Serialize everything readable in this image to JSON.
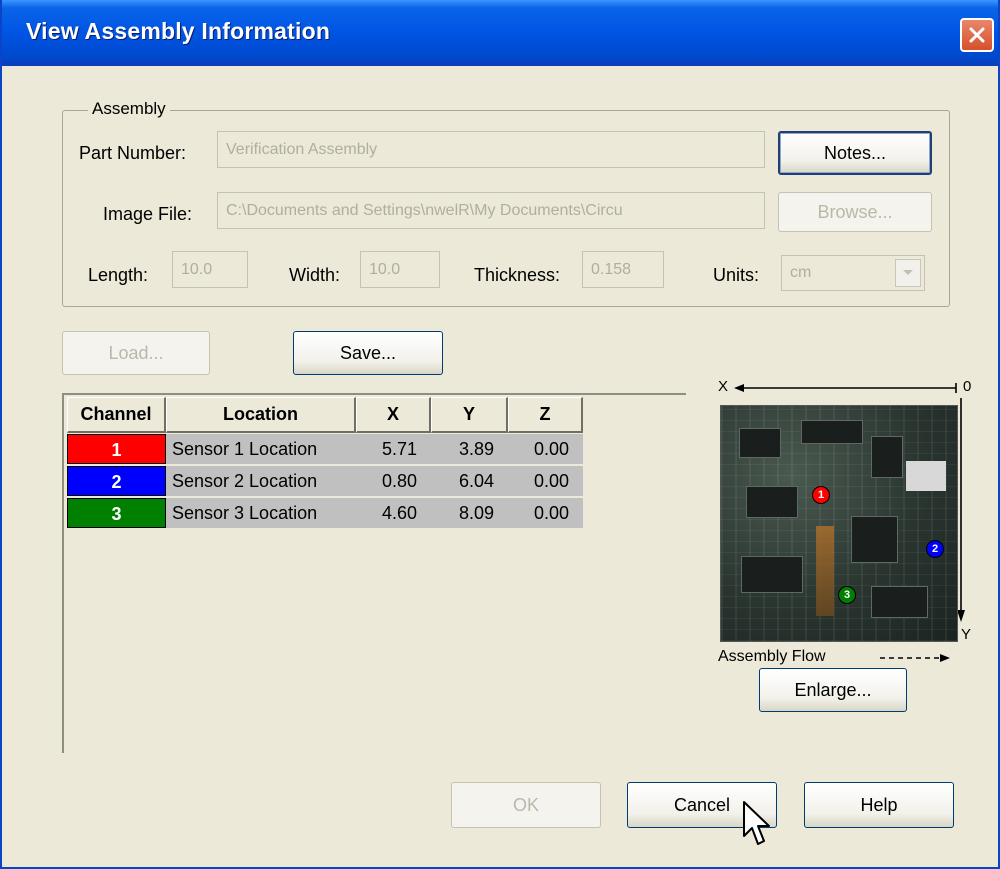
{
  "window": {
    "title": "View Assembly Information"
  },
  "assembly": {
    "group_label": "Assembly",
    "part_number_label": "Part Number:",
    "part_number_value": "Verification Assembly",
    "image_file_label": "Image File:",
    "image_file_value": "C:\\Documents and Settings\\nwelR\\My Documents\\Circu",
    "length_label": "Length:",
    "length_value": "10.0",
    "width_label": "Width:",
    "width_value": "10.0",
    "thickness_label": "Thickness:",
    "thickness_value": "0.158",
    "units_label": "Units:",
    "units_value": "cm",
    "notes_button": "Notes...",
    "browse_button": "Browse..."
  },
  "toolbar": {
    "load_button": "Load...",
    "save_button": "Save..."
  },
  "table": {
    "headers": [
      "Channel",
      "Location",
      "X",
      "Y",
      "Z"
    ],
    "rows": [
      {
        "channel": "1",
        "location": "Sensor 1 Location",
        "x": "5.71",
        "y": "3.89",
        "z": "0.00",
        "color": "#ff0000"
      },
      {
        "channel": "2",
        "location": "Sensor 2 Location",
        "x": "0.80",
        "y": "6.04",
        "z": "0.00",
        "color": "#0000ff"
      },
      {
        "channel": "3",
        "location": "Sensor 3 Location",
        "x": "4.60",
        "y": "8.09",
        "z": "0.00",
        "color": "#008000"
      }
    ]
  },
  "preview": {
    "x_axis_label": "X",
    "origin_label": "0",
    "y_axis_label": "Y",
    "flow_label": "Assembly Flow",
    "enlarge_button": "Enlarge...",
    "markers": [
      "1",
      "2",
      "3"
    ]
  },
  "footer": {
    "ok_button": "OK",
    "cancel_button": "Cancel",
    "help_button": "Help"
  }
}
